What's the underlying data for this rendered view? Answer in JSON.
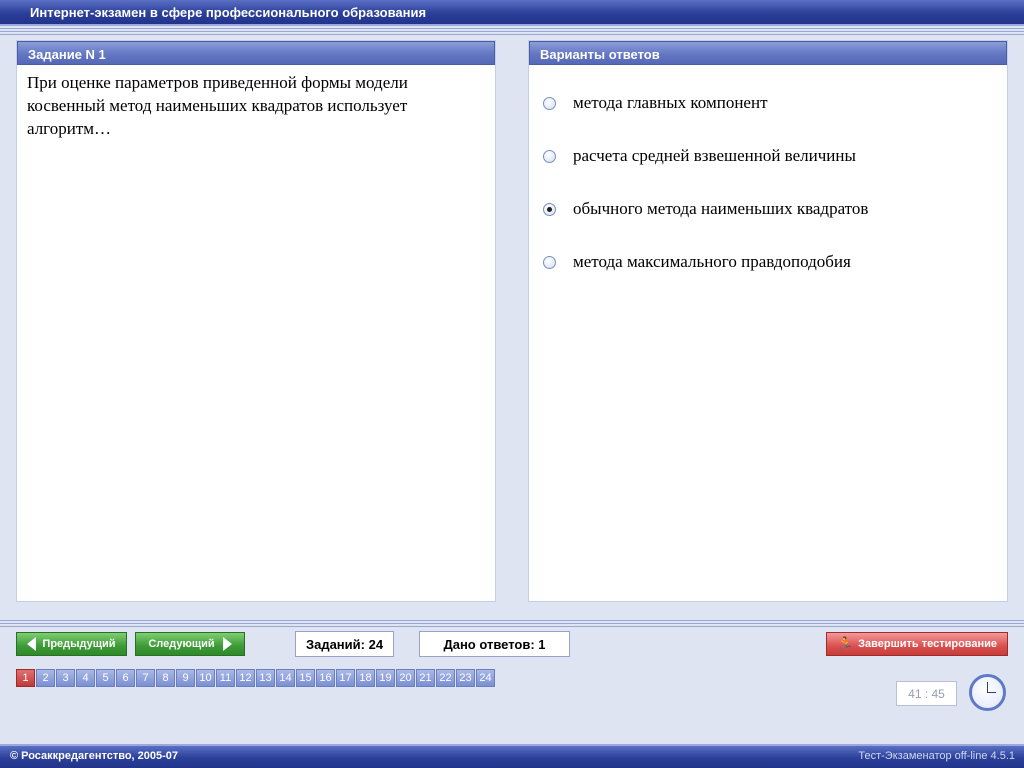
{
  "window": {
    "title": "Интернет-экзамен в сфере профессионального образования"
  },
  "question": {
    "header": "Задание N 1",
    "text": "При оценке параметров приведенной формы модели косвенный метод наименьших квадратов использует алгоритм…"
  },
  "answers": {
    "header": "Варианты ответов",
    "options": [
      {
        "label": "метода главных компонент",
        "selected": false
      },
      {
        "label": "расчета средней взвешенной величины",
        "selected": false
      },
      {
        "label": "обычного метода наименьших квадратов",
        "selected": true
      },
      {
        "label": "метода максимального правдоподобия",
        "selected": false
      }
    ]
  },
  "nav": {
    "prev_label": "Предыдущий",
    "next_label": "Следующий",
    "tasks_count_label": "Заданий: 24",
    "answered_label": "Дано ответов: 1",
    "finish_label": "Завершить тестирование"
  },
  "pager": {
    "pages": [
      "1",
      "2",
      "3",
      "4",
      "5",
      "6",
      "7",
      "8",
      "9",
      "10",
      "11",
      "12",
      "13",
      "14",
      "15",
      "16",
      "17",
      "18",
      "19",
      "20",
      "21",
      "22",
      "23",
      "24"
    ],
    "active": "1"
  },
  "timer": {
    "value": "41 : 45"
  },
  "footer": {
    "copyright": "© Росаккредагентство, 2005-07",
    "version": "Тест-Экзаменатор off-line 4.5.1"
  },
  "colors": {
    "titlebar": "#2b3f99",
    "panel_header": "#6477c3",
    "nav_button": "#3d9a36",
    "finish_button": "#d9514f",
    "active_page": "#c23a3a"
  }
}
